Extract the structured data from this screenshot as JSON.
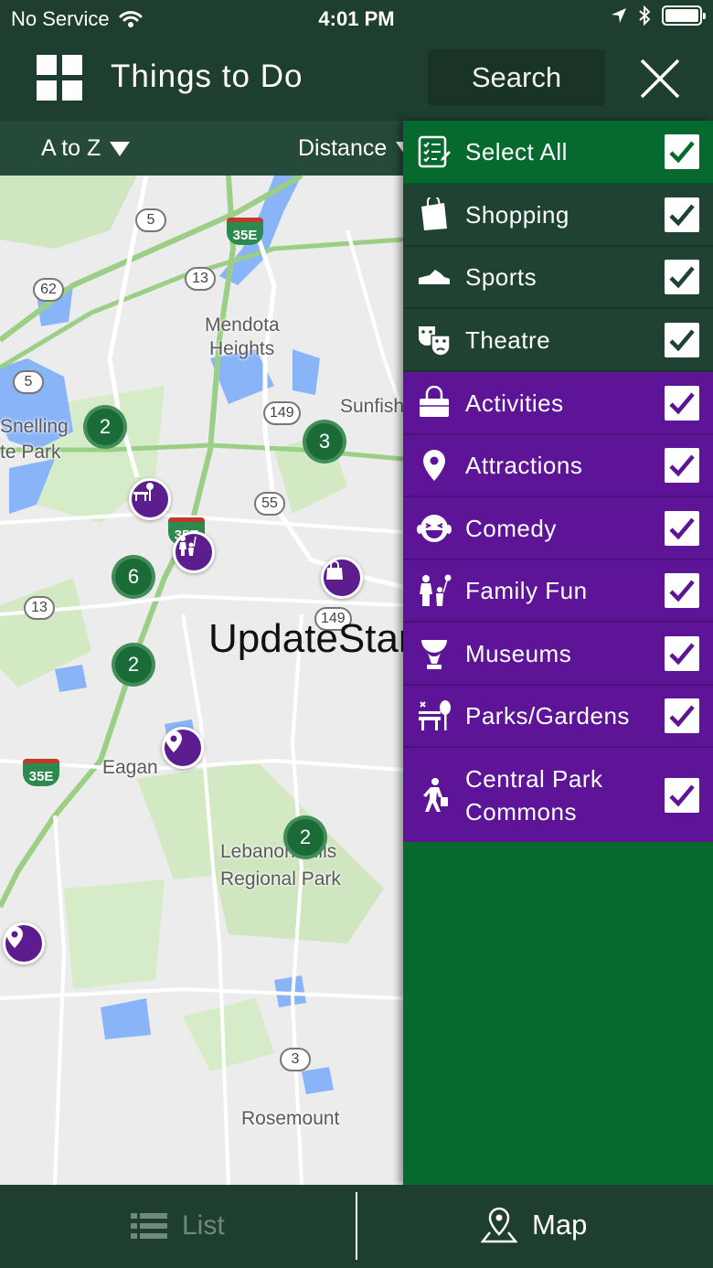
{
  "status": {
    "carrier": "No Service",
    "time": "4:01 PM"
  },
  "header": {
    "title": "Things to Do",
    "search_label": "Search"
  },
  "sort": {
    "alpha_label": "A to Z",
    "distance_label": "Distance"
  },
  "map": {
    "labels": [
      "Mendota",
      "Heights",
      "Sunfish",
      "Snelling",
      "te Park",
      "Eagan",
      "Lebanon Hills",
      "Regional Park",
      "Rosemount"
    ],
    "route_shields": [
      "5",
      "13",
      "62",
      "5",
      "149",
      "55",
      "13",
      "149",
      "3"
    ],
    "interstate_shields": [
      "35E",
      "35E",
      "35E"
    ],
    "clusters": [
      "2",
      "3",
      "6",
      "2",
      "2"
    ],
    "watermark": "UpdateStar.com"
  },
  "filters": {
    "select_all": "Select All",
    "items": [
      {
        "label": "Shopping",
        "icon": "shopping-bag-icon",
        "checked": true
      },
      {
        "label": "Sports",
        "icon": "sneaker-icon",
        "checked": true
      },
      {
        "label": "Theatre",
        "icon": "theatre-masks-icon",
        "checked": true
      },
      {
        "label": "Activities",
        "icon": "basket-icon",
        "checked": true
      },
      {
        "label": "Attractions",
        "icon": "map-pin-icon",
        "checked": true
      },
      {
        "label": "Comedy",
        "icon": "laughing-face-icon",
        "checked": true
      },
      {
        "label": "Family Fun",
        "icon": "family-icon",
        "checked": true
      },
      {
        "label": "Museums",
        "icon": "museum-icon",
        "checked": true
      },
      {
        "label": "Parks/Gardens",
        "icon": "park-bench-icon",
        "checked": true
      },
      {
        "label": "Central Park Commons",
        "icon": "walking-person-icon",
        "checked": true
      }
    ],
    "colors": {
      "core": "#1f4232",
      "select_all": "#06692e",
      "category": "#5d1497"
    }
  },
  "tabs": {
    "list_label": "List",
    "map_label": "Map"
  }
}
